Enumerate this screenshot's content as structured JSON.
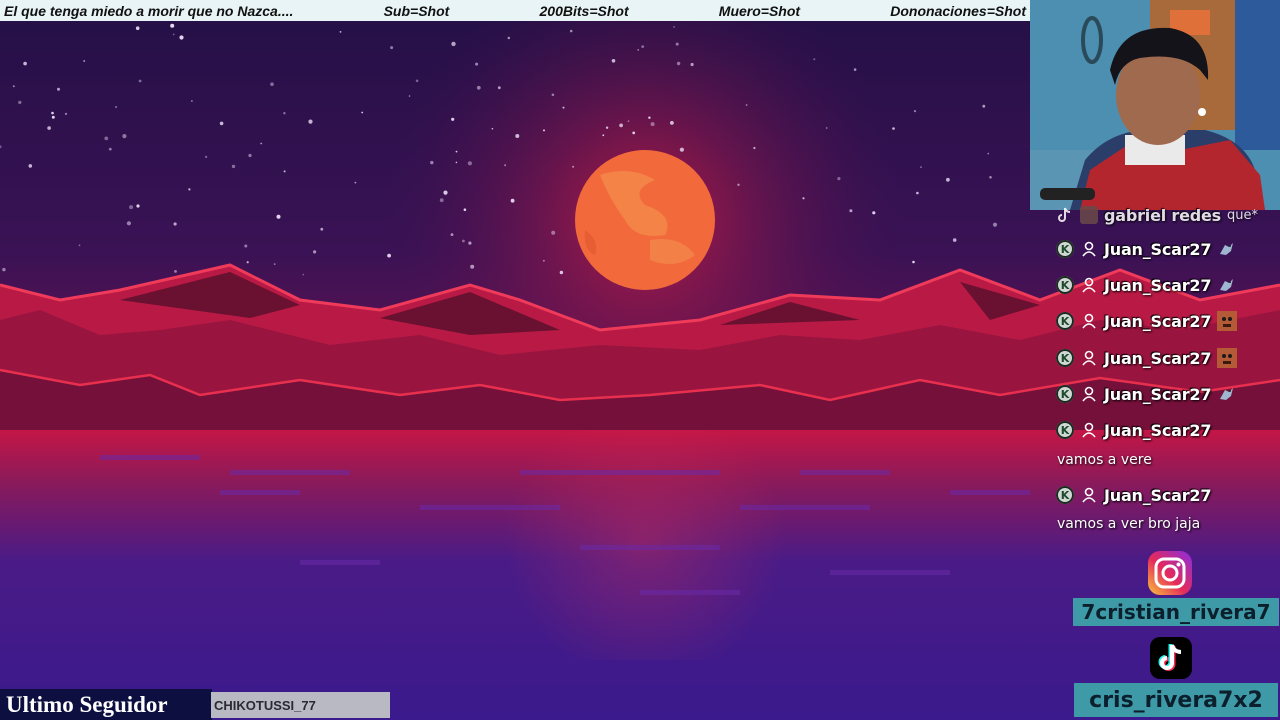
{
  "ticker": {
    "items": [
      "El que tenga miedo a morir que no Nazca....",
      "Sub=Shot",
      "200Bits=Shot",
      "Muero=Shot",
      "Dononaciones=Shot"
    ]
  },
  "chat": {
    "partial_top": {
      "name": "gabriel redes",
      "text": "que*"
    },
    "rows": [
      {
        "name": "Juan_Scar27",
        "emote": "bird-emote"
      },
      {
        "name": "Juan_Scar27",
        "emote": "bird-emote"
      },
      {
        "name": "Juan_Scar27",
        "emote": "face-emote"
      },
      {
        "name": "Juan_Scar27",
        "emote": "face-emote"
      },
      {
        "name": "Juan_Scar27",
        "emote": "bird-emote"
      },
      {
        "name": "Juan_Scar27",
        "emote": ""
      },
      {
        "name": "Juan_Scar27",
        "emote": ""
      }
    ],
    "messages": [
      "vamos a vere",
      "vamos a ver bro jaja"
    ],
    "badge_glyph": "K"
  },
  "socials": {
    "instagram": "7cristian_rivera7",
    "tiktok": "cris_rivera7x2"
  },
  "follower": {
    "label": "Ultimo Seguidor",
    "name": "CHIKOTUSSI_77"
  },
  "colors": {
    "sky_top": "#2a0f4a",
    "moon": "#f06a3a",
    "mountains": "#e0284a",
    "social_bg": "#3f9aa8"
  }
}
